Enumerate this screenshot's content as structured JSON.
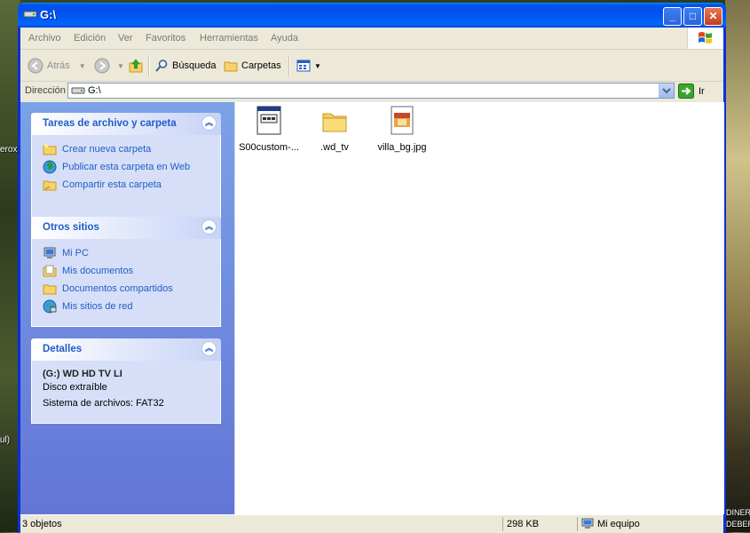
{
  "window": {
    "title": "G:\\"
  },
  "menu": [
    "Archivo",
    "Edición",
    "Ver",
    "Favoritos",
    "Herramientas",
    "Ayuda"
  ],
  "toolbar": {
    "back": "Atrás",
    "search": "Búsqueda",
    "folders": "Carpetas"
  },
  "address": {
    "label": "Dirección",
    "value": "G:\\",
    "go": "Ir"
  },
  "tasks": {
    "title": "Tareas de archivo y carpeta",
    "items": [
      "Crear nueva carpeta",
      "Publicar esta carpeta en Web",
      "Compartir esta carpeta"
    ]
  },
  "places": {
    "title": "Otros sitios",
    "items": [
      "Mi PC",
      "Mis documentos",
      "Documentos compartidos",
      "Mis sitios de red"
    ]
  },
  "details": {
    "title": "Detalles",
    "name": "(G:) WD HD TV LI",
    "type": "Disco extraíble",
    "fs": "Sistema de archivos: FAT32"
  },
  "files": [
    {
      "name": "S00custom-...",
      "icon": "installer-icon"
    },
    {
      "name": ".wd_tv",
      "icon": "folder-icon"
    },
    {
      "name": "villa_bg.jpg",
      "icon": "image-file-icon"
    }
  ],
  "status": {
    "count": "3 objetos",
    "size": "298 KB",
    "location": "Mi equipo"
  },
  "desktop": {
    "left_text_1": "erox",
    "left_text_2": "ul)",
    "right_text_1": "DINER",
    "right_text_2": "DEBER"
  }
}
